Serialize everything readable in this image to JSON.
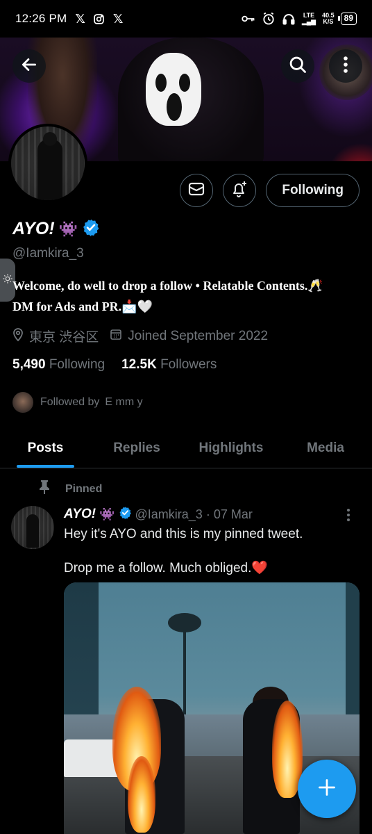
{
  "status_bar": {
    "time": "12:26 PM",
    "network": "LTE",
    "speed_value": "40.5",
    "speed_unit": "K/S",
    "battery": "89",
    "left_icons": [
      "x-logo-icon",
      "instagram-icon",
      "x-logo-icon"
    ],
    "right_icons": [
      "key-icon",
      "alarm-icon",
      "headset-icon",
      "signal-icon"
    ]
  },
  "banner": {
    "back_icon": "arrow-left-icon",
    "search_icon": "search-icon",
    "more_icon": "more-vertical-icon"
  },
  "actions": {
    "message_icon": "envelope-icon",
    "notify_icon": "bell-plus-icon",
    "following_label": "Following"
  },
  "profile": {
    "display_name": "AYO!",
    "name_emoji": "👾",
    "handle": "@Iamkira_3",
    "bio_line1": "Welcome, do well to drop a follow • Relatable Contents.🥂",
    "bio_line2": "DM for Ads and PR.📩🤍",
    "location": "東京 渋谷区",
    "joined": "Joined September 2022",
    "following_count": "5,490",
    "following_label": "Following",
    "followers_count": "12.5K",
    "followers_label": "Followers",
    "followed_by_prefix": "Followed by",
    "followed_by_name": "E mm y"
  },
  "tabs": [
    {
      "label": "Posts",
      "active": true
    },
    {
      "label": "Replies",
      "active": false
    },
    {
      "label": "Highlights",
      "active": false
    },
    {
      "label": "Media",
      "active": false
    }
  ],
  "pinned_tweet": {
    "pinned_label": "Pinned",
    "name": "AYO!",
    "name_emoji": "👾",
    "handle": "@Iamkira_3",
    "date": "· 07 Mar",
    "text_line1": "Hey it's AYO and this is my pinned tweet.",
    "text_line2": "Drop me a follow. Much obliged.❤️"
  },
  "fab": {
    "icon": "plus-icon"
  },
  "colors": {
    "accent": "#1d9bf0",
    "background": "#000000",
    "text_primary": "#e7e9ea",
    "text_secondary": "#71767b",
    "border": "#2f3336"
  }
}
